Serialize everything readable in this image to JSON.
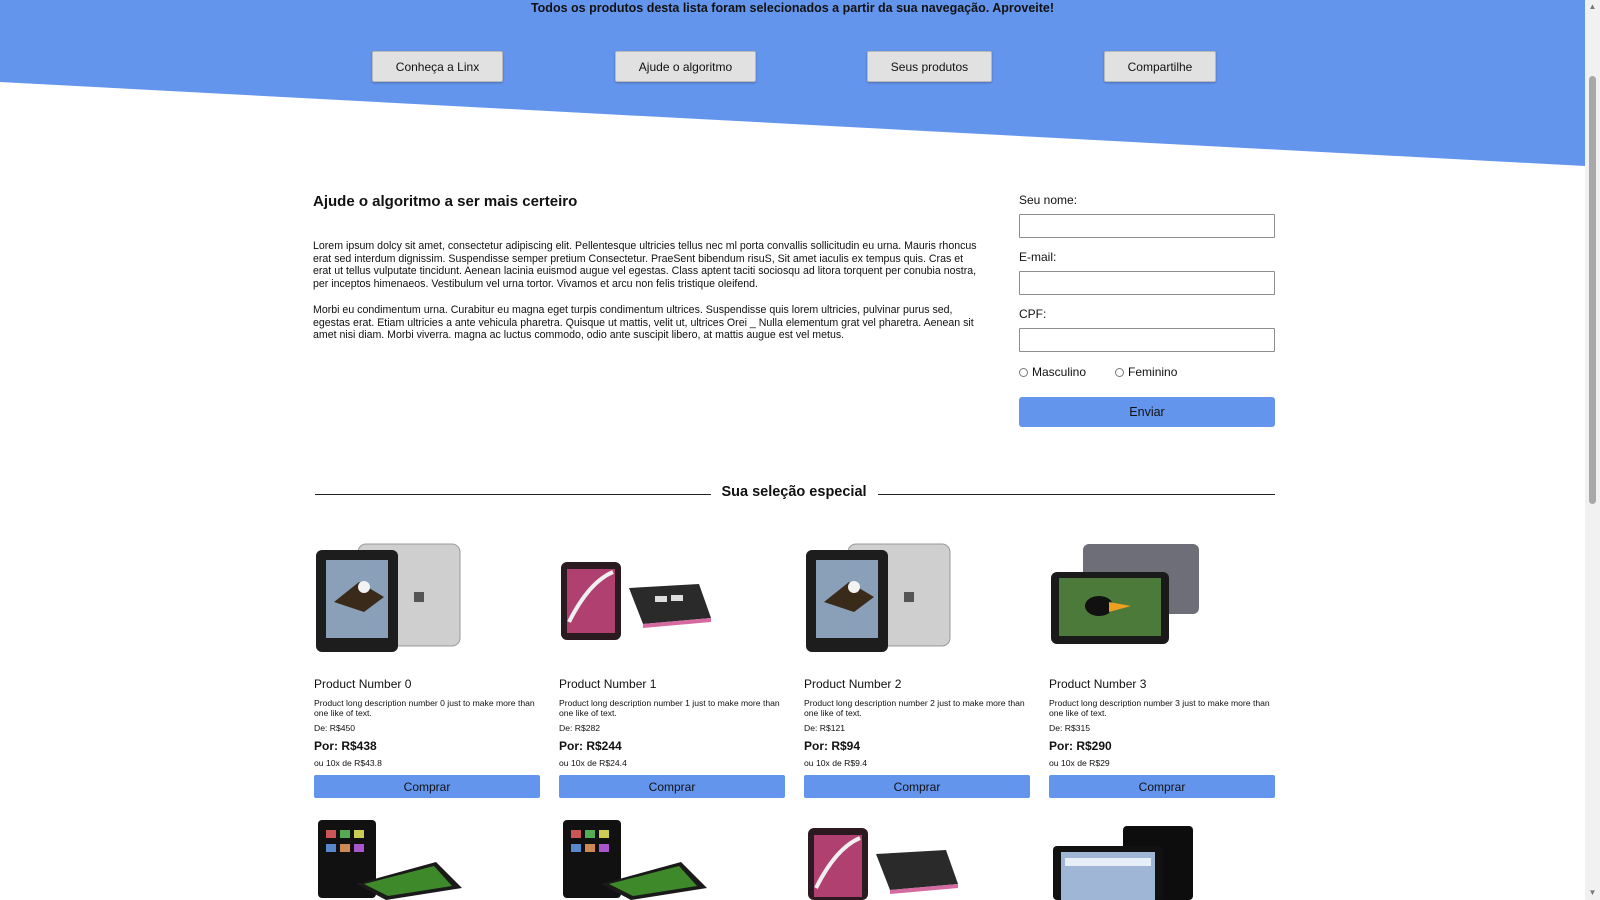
{
  "header": {
    "banner_text": "Todos os produtos desta lista foram selecionados a partir da sua navegação. Aproveite!",
    "background_color": "#6495ed",
    "nav": [
      {
        "label": "Conheça a Linx"
      },
      {
        "label": "Ajude o algoritmo"
      },
      {
        "label": "Seus produtos"
      },
      {
        "label": "Compartilhe"
      }
    ]
  },
  "intro": {
    "title": "Ajude o algoritmo a ser mais certeiro",
    "paragraphs": [
      "Lorem ipsum dolcy sit amet, consectetur adipiscing elit. Pellentesque ultricies tellus nec ml porta convallis sollicitudin eu urna. Mauris rhoncus erat sed interdum dignissim. Suspendisse semper pretium Consectetur. PraeSent bibendum risuS, Sit amet iaculis ex tempus quis. Cras et erat ut tellus vulputate tincidunt. Aenean lacinia euismod augue vel egestas. Class aptent taciti sociosqu ad litora torquent per conubia nostra, per inceptos himenaeos. Vestibulum vel urna tortor. Vivamos et arcu non felis tristique oleifend.",
      "Morbi eu condimentum urna. Curabitur eu magna eget turpis condimentum ultrices. Suspendisse quis lorem ultricies, pulvinar purus sed, egestas erat. Etiam ultricies a ante vehicula pharetra. Quisque ut mattis, velit ut, ultrices Orei _ Nulla elementum grat vel pharetra. Aenean sit amet nisi diam. Morbi viverra. magna ac luctus commodo, odio ante suscipit libero, at mattis augue est vel metus."
    ]
  },
  "form": {
    "name_label": "Seu nome:",
    "name_value": "",
    "email_label": "E-mail:",
    "email_value": "",
    "cpf_label": "CPF:",
    "cpf_value": "",
    "gender_options": [
      "Masculino",
      "Feminino"
    ],
    "submit_label": "Enviar"
  },
  "selection": {
    "title": "Sua seleção especial",
    "products": [
      {
        "name": "Product Number 0",
        "description": "Product long description number 0 just to make more than one like of text.",
        "old_price": "De: R$450",
        "price": "Por: R$438",
        "installments": "ou 10x de R$43.8",
        "buy_label": "Comprar",
        "image": "tablet-silver-eagle"
      },
      {
        "name": "Product Number 1",
        "description": "Product long description number 1 just to make more than one like of text.",
        "old_price": "De: R$282",
        "price": "Por: R$244",
        "installments": "ou 10x de R$24.4",
        "buy_label": "Comprar",
        "image": "tablet-pink-swirl"
      },
      {
        "name": "Product Number 2",
        "description": "Product long description number 2 just to make more than one like of text.",
        "old_price": "De: R$121",
        "price": "Por: R$94",
        "installments": "ou 10x de R$9.4",
        "buy_label": "Comprar",
        "image": "tablet-silver-eagle"
      },
      {
        "name": "Product Number 3",
        "description": "Product long description number 3 just to make more than one like of text.",
        "old_price": "De: R$315",
        "price": "Por: R$290",
        "installments": "ou 10x de R$29",
        "buy_label": "Comprar",
        "image": "tablet-toucan"
      }
    ],
    "next_row_images": [
      "tablet-icons-green",
      "tablet-icons-green",
      "tablet-pink-swirl",
      "tablet-black-screen"
    ]
  }
}
